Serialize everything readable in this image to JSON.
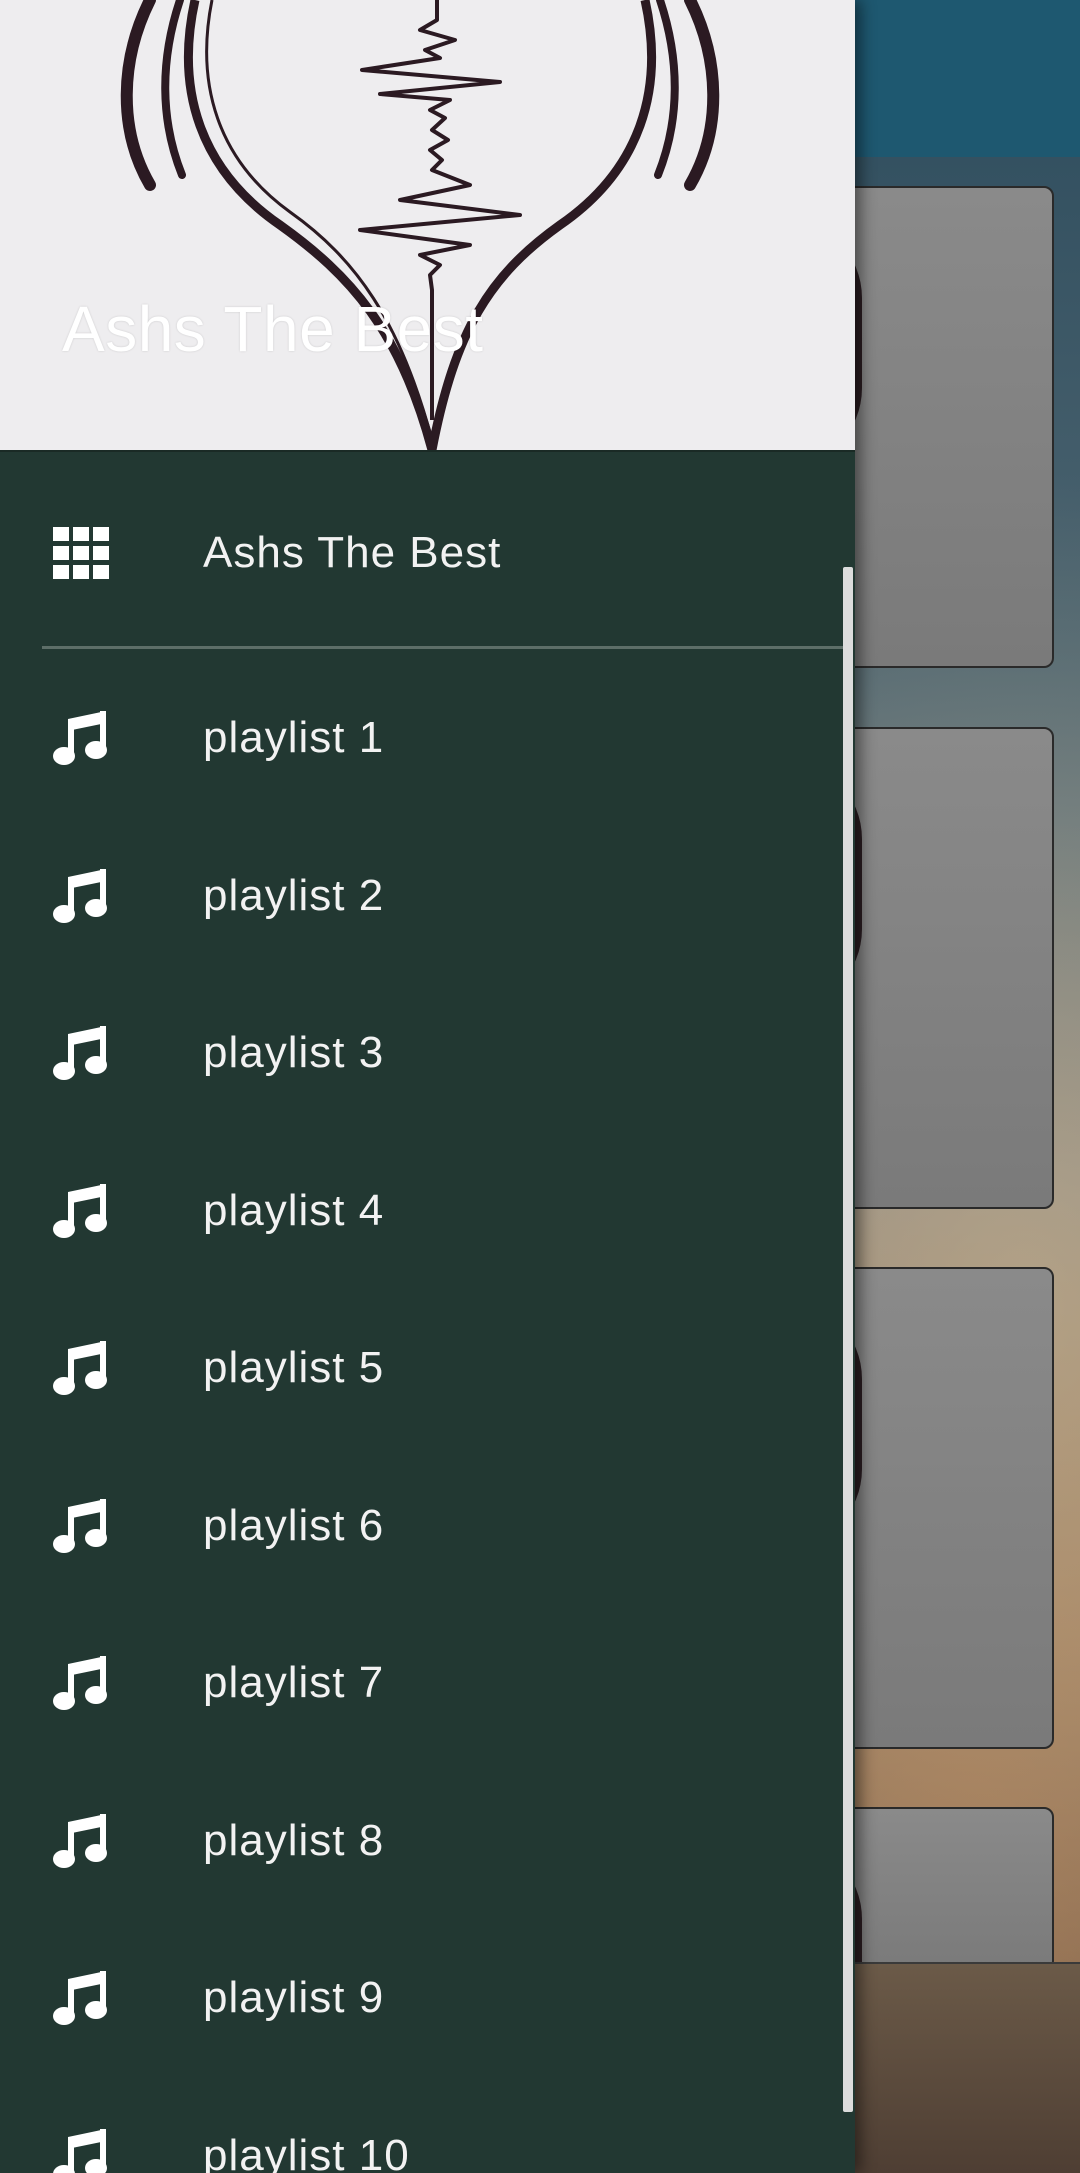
{
  "header": {
    "title": "Ashs The Best"
  },
  "menu": {
    "top_item": {
      "label": "Ashs The Best",
      "icon": "apps-grid-icon"
    },
    "playlists": [
      {
        "label": "playlist 1",
        "icon": "music-note-icon"
      },
      {
        "label": "playlist 2",
        "icon": "music-note-icon"
      },
      {
        "label": "playlist 3",
        "icon": "music-note-icon"
      },
      {
        "label": "playlist 4",
        "icon": "music-note-icon"
      },
      {
        "label": "playlist 5",
        "icon": "music-note-icon"
      },
      {
        "label": "playlist 6",
        "icon": "music-note-icon"
      },
      {
        "label": "playlist 7",
        "icon": "music-note-icon"
      },
      {
        "label": "playlist 8",
        "icon": "music-note-icon"
      },
      {
        "label": "playlist 9",
        "icon": "music-note-icon"
      },
      {
        "label": "playlist 10",
        "icon": "music-note-icon"
      }
    ]
  },
  "colors": {
    "drawer_background": "#223832",
    "header_background": "#eeedef",
    "text": "#f2f2f2",
    "app_bar": "#1e5870"
  }
}
